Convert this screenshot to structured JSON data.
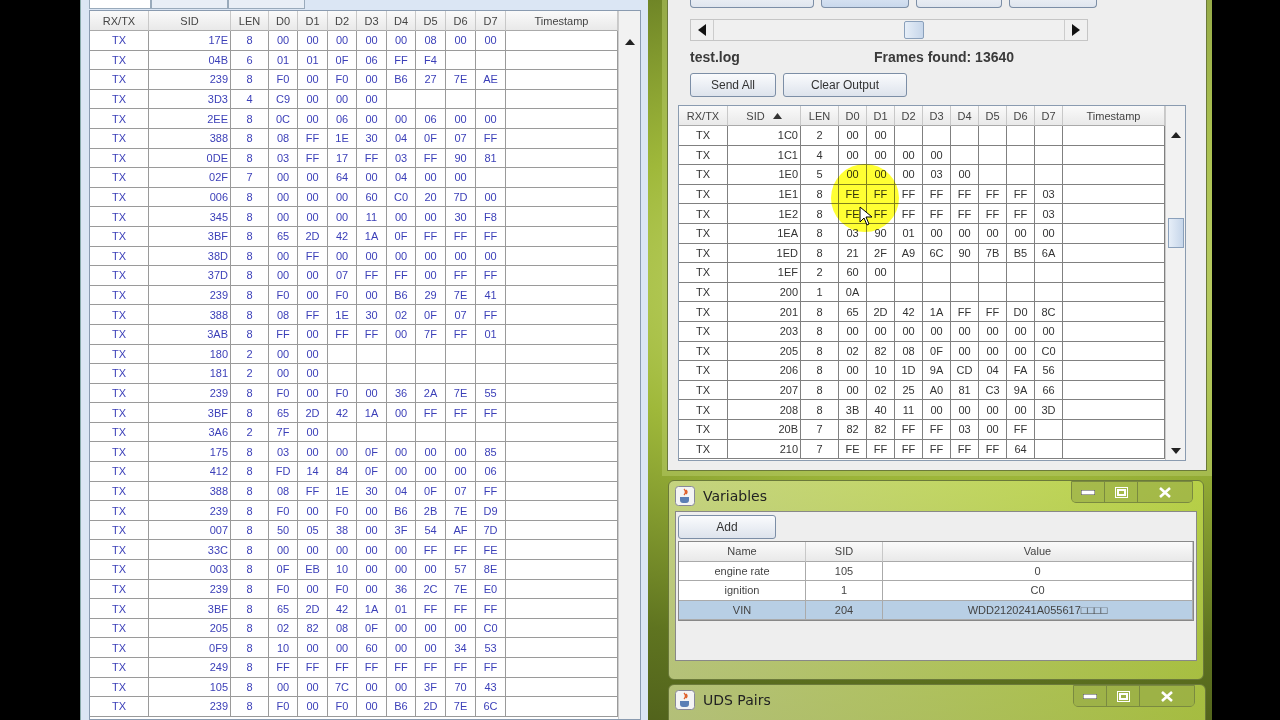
{
  "log_tabs": [
    {
      "selected": true
    },
    {
      "selected": false
    },
    {
      "selected": false
    }
  ],
  "log_table": {
    "columns": [
      "RX/TX",
      "SID",
      "LEN",
      "D0",
      "D1",
      "D2",
      "D3",
      "D4",
      "D5",
      "D6",
      "D7",
      "Timestamp"
    ],
    "rows": [
      {
        "dir": "TX",
        "sid": "17E",
        "len": "8",
        "data": [
          "00",
          "00",
          "00",
          "00",
          "00",
          "08",
          "00",
          "00"
        ]
      },
      {
        "dir": "TX",
        "sid": "04B",
        "len": "6",
        "data": [
          "01",
          "01",
          "0F",
          "06",
          "FF",
          "F4"
        ]
      },
      {
        "dir": "TX",
        "sid": "239",
        "len": "8",
        "data": [
          "F0",
          "00",
          "F0",
          "00",
          "B6",
          "27",
          "7E",
          "AE"
        ]
      },
      {
        "dir": "TX",
        "sid": "3D3",
        "len": "4",
        "data": [
          "C9",
          "00",
          "00",
          "00"
        ]
      },
      {
        "dir": "TX",
        "sid": "2EE",
        "len": "8",
        "data": [
          "0C",
          "00",
          "06",
          "00",
          "00",
          "06",
          "00",
          "00"
        ]
      },
      {
        "dir": "TX",
        "sid": "388",
        "len": "8",
        "data": [
          "08",
          "FF",
          "1E",
          "30",
          "04",
          "0F",
          "07",
          "FF"
        ]
      },
      {
        "dir": "TX",
        "sid": "0DE",
        "len": "8",
        "data": [
          "03",
          "FF",
          "17",
          "FF",
          "03",
          "FF",
          "90",
          "81"
        ]
      },
      {
        "dir": "TX",
        "sid": "02F",
        "len": "7",
        "data": [
          "00",
          "00",
          "64",
          "00",
          "04",
          "00",
          "00"
        ]
      },
      {
        "dir": "TX",
        "sid": "006",
        "len": "8",
        "data": [
          "00",
          "00",
          "00",
          "60",
          "C0",
          "20",
          "7D",
          "00"
        ]
      },
      {
        "dir": "TX",
        "sid": "345",
        "len": "8",
        "data": [
          "00",
          "00",
          "00",
          "11",
          "00",
          "00",
          "30",
          "F8"
        ]
      },
      {
        "dir": "TX",
        "sid": "3BF",
        "len": "8",
        "data": [
          "65",
          "2D",
          "42",
          "1A",
          "0F",
          "FF",
          "FF",
          "FF"
        ]
      },
      {
        "dir": "TX",
        "sid": "38D",
        "len": "8",
        "data": [
          "00",
          "FF",
          "00",
          "00",
          "00",
          "00",
          "00",
          "00"
        ]
      },
      {
        "dir": "TX",
        "sid": "37D",
        "len": "8",
        "data": [
          "00",
          "00",
          "07",
          "FF",
          "FF",
          "00",
          "FF",
          "FF"
        ]
      },
      {
        "dir": "TX",
        "sid": "239",
        "len": "8",
        "data": [
          "F0",
          "00",
          "F0",
          "00",
          "B6",
          "29",
          "7E",
          "41"
        ]
      },
      {
        "dir": "TX",
        "sid": "388",
        "len": "8",
        "data": [
          "08",
          "FF",
          "1E",
          "30",
          "02",
          "0F",
          "07",
          "FF"
        ]
      },
      {
        "dir": "TX",
        "sid": "3AB",
        "len": "8",
        "data": [
          "FF",
          "00",
          "FF",
          "FF",
          "00",
          "7F",
          "FF",
          "01"
        ]
      },
      {
        "dir": "TX",
        "sid": "180",
        "len": "2",
        "data": [
          "00",
          "00"
        ]
      },
      {
        "dir": "TX",
        "sid": "181",
        "len": "2",
        "data": [
          "00",
          "00"
        ]
      },
      {
        "dir": "TX",
        "sid": "239",
        "len": "8",
        "data": [
          "F0",
          "00",
          "F0",
          "00",
          "36",
          "2A",
          "7E",
          "55"
        ]
      },
      {
        "dir": "TX",
        "sid": "3BF",
        "len": "8",
        "data": [
          "65",
          "2D",
          "42",
          "1A",
          "00",
          "FF",
          "FF",
          "FF"
        ]
      },
      {
        "dir": "TX",
        "sid": "3A6",
        "len": "2",
        "data": [
          "7F",
          "00"
        ]
      },
      {
        "dir": "TX",
        "sid": "175",
        "len": "8",
        "data": [
          "03",
          "00",
          "00",
          "0F",
          "00",
          "00",
          "00",
          "85"
        ]
      },
      {
        "dir": "TX",
        "sid": "412",
        "len": "8",
        "data": [
          "FD",
          "14",
          "84",
          "0F",
          "00",
          "00",
          "00",
          "06"
        ]
      },
      {
        "dir": "TX",
        "sid": "388",
        "len": "8",
        "data": [
          "08",
          "FF",
          "1E",
          "30",
          "04",
          "0F",
          "07",
          "FF"
        ]
      },
      {
        "dir": "TX",
        "sid": "239",
        "len": "8",
        "data": [
          "F0",
          "00",
          "F0",
          "00",
          "B6",
          "2B",
          "7E",
          "D9"
        ]
      },
      {
        "dir": "TX",
        "sid": "007",
        "len": "8",
        "data": [
          "50",
          "05",
          "38",
          "00",
          "3F",
          "54",
          "AF",
          "7D"
        ]
      },
      {
        "dir": "TX",
        "sid": "33C",
        "len": "8",
        "data": [
          "00",
          "00",
          "00",
          "00",
          "00",
          "FF",
          "FF",
          "FE"
        ]
      },
      {
        "dir": "TX",
        "sid": "003",
        "len": "8",
        "data": [
          "0F",
          "EB",
          "10",
          "00",
          "00",
          "00",
          "57",
          "8E"
        ]
      },
      {
        "dir": "TX",
        "sid": "239",
        "len": "8",
        "data": [
          "F0",
          "00",
          "F0",
          "00",
          "36",
          "2C",
          "7E",
          "E0"
        ]
      },
      {
        "dir": "TX",
        "sid": "3BF",
        "len": "8",
        "data": [
          "65",
          "2D",
          "42",
          "1A",
          "01",
          "FF",
          "FF",
          "FF"
        ]
      },
      {
        "dir": "TX",
        "sid": "205",
        "len": "8",
        "data": [
          "02",
          "82",
          "08",
          "0F",
          "00",
          "00",
          "00",
          "C0"
        ]
      },
      {
        "dir": "TX",
        "sid": "0F9",
        "len": "8",
        "data": [
          "10",
          "00",
          "00",
          "60",
          "00",
          "00",
          "34",
          "53"
        ]
      },
      {
        "dir": "TX",
        "sid": "249",
        "len": "8",
        "data": [
          "FF",
          "FF",
          "FF",
          "FF",
          "FF",
          "FF",
          "FF",
          "FF"
        ]
      },
      {
        "dir": "TX",
        "sid": "105",
        "len": "8",
        "data": [
          "00",
          "00",
          "7C",
          "00",
          "00",
          "3F",
          "70",
          "43"
        ]
      },
      {
        "dir": "TX",
        "sid": "239",
        "len": "8",
        "data": [
          "F0",
          "00",
          "F0",
          "00",
          "B6",
          "2D",
          "7E",
          "6C"
        ]
      }
    ]
  },
  "player": {
    "file": "test.log",
    "frames_found": "Frames found: 13640",
    "buttons": [
      "Send All",
      "Clear Output"
    ]
  },
  "output_table": {
    "columns": [
      {
        "label": "RX/TX",
        "sorted": false
      },
      {
        "label": "SID",
        "sorted": true
      },
      {
        "label": "LEN",
        "sorted": false
      },
      {
        "label": "D0",
        "sorted": false
      },
      {
        "label": "D1",
        "sorted": false
      },
      {
        "label": "D2",
        "sorted": false
      },
      {
        "label": "D3",
        "sorted": false
      },
      {
        "label": "D4",
        "sorted": false
      },
      {
        "label": "D5",
        "sorted": false
      },
      {
        "label": "D6",
        "sorted": false
      },
      {
        "label": "D7",
        "sorted": false
      },
      {
        "label": "Timestamp",
        "sorted": false
      }
    ],
    "rows": [
      {
        "dir": "TX",
        "sid": "1C0",
        "len": "2",
        "data": [
          "00",
          "00"
        ]
      },
      {
        "dir": "TX",
        "sid": "1C1",
        "len": "4",
        "data": [
          "00",
          "00",
          "00",
          "00"
        ]
      },
      {
        "dir": "TX",
        "sid": "1E0",
        "len": "5",
        "data": [
          "00",
          "00",
          "00",
          "03",
          "00"
        ]
      },
      {
        "dir": "TX",
        "sid": "1E1",
        "len": "8",
        "data": [
          "FE",
          "FF",
          "FF",
          "FF",
          "FF",
          "FF",
          "FF",
          "03"
        ]
      },
      {
        "dir": "TX",
        "sid": "1E2",
        "len": "8",
        "data": [
          "FE",
          "FF",
          "FF",
          "FF",
          "FF",
          "FF",
          "FF",
          "03"
        ]
      },
      {
        "dir": "TX",
        "sid": "1EA",
        "len": "8",
        "data": [
          "03",
          "90",
          "01",
          "00",
          "00",
          "00",
          "00",
          "00"
        ]
      },
      {
        "dir": "TX",
        "sid": "1ED",
        "len": "8",
        "data": [
          "21",
          "2F",
          "A9",
          "6C",
          "90",
          "7B",
          "B5",
          "6A"
        ]
      },
      {
        "dir": "TX",
        "sid": "1EF",
        "len": "2",
        "data": [
          "60",
          "00"
        ]
      },
      {
        "dir": "TX",
        "sid": "200",
        "len": "1",
        "data": [
          "0A"
        ]
      },
      {
        "dir": "TX",
        "sid": "201",
        "len": "8",
        "data": [
          "65",
          "2D",
          "42",
          "1A",
          "FF",
          "FF",
          "D0",
          "8C"
        ]
      },
      {
        "dir": "TX",
        "sid": "203",
        "len": "8",
        "data": [
          "00",
          "00",
          "00",
          "00",
          "00",
          "00",
          "00",
          "00"
        ]
      },
      {
        "dir": "TX",
        "sid": "205",
        "len": "8",
        "data": [
          "02",
          "82",
          "08",
          "0F",
          "00",
          "00",
          "00",
          "C0"
        ]
      },
      {
        "dir": "TX",
        "sid": "206",
        "len": "8",
        "data": [
          "00",
          "10",
          "1D",
          "9A",
          "CD",
          "04",
          "FA",
          "56"
        ]
      },
      {
        "dir": "TX",
        "sid": "207",
        "len": "8",
        "data": [
          "00",
          "02",
          "25",
          "A0",
          "81",
          "C3",
          "9A",
          "66"
        ]
      },
      {
        "dir": "TX",
        "sid": "208",
        "len": "8",
        "data": [
          "3B",
          "40",
          "11",
          "00",
          "00",
          "00",
          "00",
          "3D"
        ]
      },
      {
        "dir": "TX",
        "sid": "20B",
        "len": "7",
        "data": [
          "82",
          "82",
          "FF",
          "FF",
          "03",
          "00",
          "FF"
        ]
      },
      {
        "dir": "TX",
        "sid": "210",
        "len": "7",
        "data": [
          "FE",
          "FF",
          "FF",
          "FF",
          "FF",
          "FF",
          "64"
        ]
      }
    ]
  },
  "variables_window": {
    "title": "Variables",
    "add_button": "Add",
    "columns": [
      "Name",
      "SID",
      "Value"
    ],
    "rows": [
      {
        "name": "engine rate",
        "sid": "105",
        "value": "0",
        "selected": false
      },
      {
        "name": "ignition",
        "sid": "1",
        "value": "C0",
        "selected": false
      },
      {
        "name": "VIN",
        "sid": "204",
        "value": "WDD2120241A055617□□□□",
        "selected": true
      }
    ]
  },
  "uds_window": {
    "title": "UDS Pairs"
  }
}
